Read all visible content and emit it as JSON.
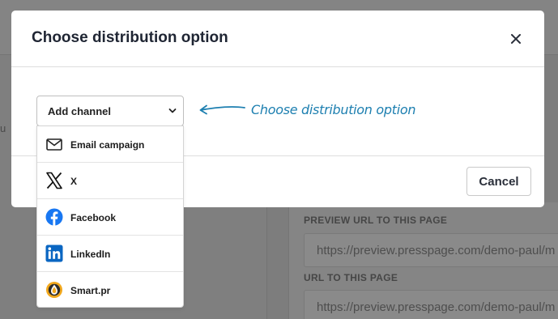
{
  "background": {
    "left_stub_text": "u",
    "preview_label": "PREVIEW URL TO THIS PAGE",
    "preview_url": "https://preview.presspage.com/demo-paul/m",
    "url_label": "URL TO THIS PAGE",
    "url_value": "https://preview.presspage.com/demo-paul/m"
  },
  "modal": {
    "title": "Choose distribution option",
    "close_icon": "close-icon",
    "cancel_label": "Cancel"
  },
  "select": {
    "label": "Add channel",
    "icon": "chevron-down-icon"
  },
  "menu": {
    "items": [
      {
        "label": "Email campaign",
        "icon": "envelope-icon"
      },
      {
        "label": "X",
        "icon": "x-logo-icon"
      },
      {
        "label": "Facebook",
        "icon": "facebook-icon",
        "color": "#1877f2"
      },
      {
        "label": "LinkedIn",
        "icon": "linkedin-icon",
        "color": "#0a66c2"
      },
      {
        "label": "Smart.pr",
        "icon": "smartpr-icon",
        "color": "#f2a81d"
      }
    ]
  },
  "hint": {
    "text": "Choose distribution option",
    "color": "#1d7fb0"
  }
}
